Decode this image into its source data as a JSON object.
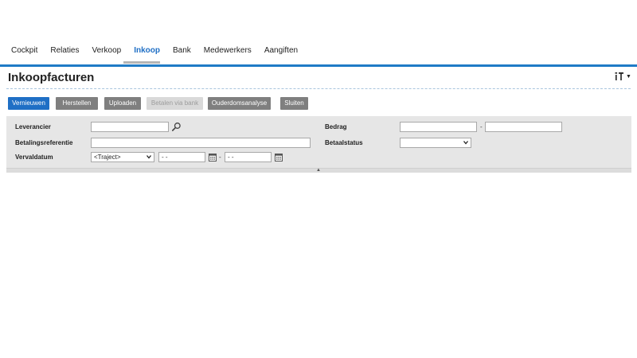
{
  "nav": {
    "items": [
      {
        "label": "Cockpit"
      },
      {
        "label": "Relaties"
      },
      {
        "label": "Verkoop"
      },
      {
        "label": "Inkoop"
      },
      {
        "label": "Bank"
      },
      {
        "label": "Medewerkers"
      },
      {
        "label": "Aangiften"
      }
    ],
    "active": "Inkoop"
  },
  "page": {
    "title": "Inkoopfacturen",
    "settings_icon": "settings-icon"
  },
  "toolbar": {
    "vernieuwen": "Vernieuwen",
    "herstellen": "Herstellen",
    "uploaden": "Uploaden",
    "betalen": "Betalen via bank",
    "ouderdom": "Ouderdomsanalyse",
    "sluiten": "Sluiten"
  },
  "filters": {
    "leverancier": {
      "label": "Leverancier",
      "value": ""
    },
    "betalingsreferentie": {
      "label": "Betalingsreferentie",
      "value": ""
    },
    "vervaldatum": {
      "label": "Vervaldatum",
      "range_value": "<Traject>",
      "from": "- -",
      "to": "- -",
      "separator": "-"
    },
    "bedrag": {
      "label": "Bedrag",
      "from": "",
      "to": "",
      "separator": "-"
    },
    "betaalstatus": {
      "label": "Betaalstatus",
      "value": ""
    }
  },
  "colors": {
    "accent": "#1f6fc5",
    "nav_bar": "#1f7bc6",
    "button_grey": "#7f7f7f",
    "panel_bg": "#e6e6e6"
  }
}
